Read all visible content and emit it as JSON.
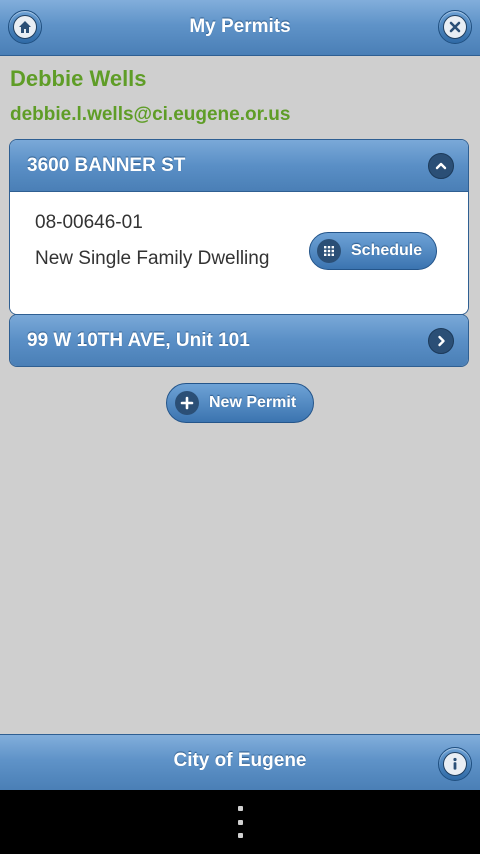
{
  "header": {
    "title": "My Permits",
    "home_icon": "home-icon",
    "close_icon": "close-icon"
  },
  "user": {
    "name": "Debbie Wells",
    "email": "debbie.l.wells@ci.eugene.or.us"
  },
  "permits": [
    {
      "address": "3600 BANNER ST",
      "expanded": true,
      "number": "08-00646-01",
      "description": "New Single Family Dwelling",
      "schedule_label": "Schedule",
      "toggle_icon": "chevron-up-icon"
    },
    {
      "address": "99 W 10TH AVE, Unit 101",
      "expanded": false,
      "toggle_icon": "chevron-right-icon"
    }
  ],
  "new_permit_label": "New Permit",
  "footer": {
    "title": "City of Eugene",
    "info_icon": "info-icon"
  },
  "colors": {
    "bar_blue": "#5f93c8",
    "name_green": "#5f9d27",
    "background": "#cfcfcf"
  }
}
